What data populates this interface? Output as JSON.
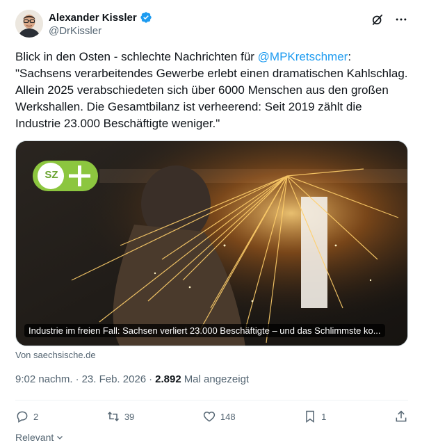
{
  "author": {
    "display_name": "Alexander Kissler",
    "handle": "@DrKissler",
    "verified": true
  },
  "header_icons": [
    "grok-icon",
    "more-icon"
  ],
  "tweet": {
    "text_before_mention": "Blick in den Osten - schlechte Nachrichten für ",
    "mention": "@MPKretschmer",
    "text_after_mention": ":\n\"Sachsens verarbeitendes Gewerbe erlebt einen dramatischen Kahlschlag. Allein 2025 verabschiedeten sich über 6000 Menschen aus den großen Werkshallen. Die Gesamtbilanz ist verheerend: Seit 2019 zählt die Industrie 23.000 Beschäftigte weniger.\""
  },
  "card": {
    "badge_text": "SZ",
    "caption": "Industrie im freien Fall: Sachsen verliert 23.000 Beschäftigte – und das Schlimmste ko...",
    "source": "Von saechsische.de"
  },
  "meta": {
    "time": "9:02 nachm.",
    "separator": "·",
    "date": "23. Feb. 2026",
    "separator2": "·",
    "views_count": "2.892",
    "views_label": "Mal angezeigt"
  },
  "actions": {
    "replies": "2",
    "reposts": "39",
    "likes": "148",
    "bookmarks": "1"
  },
  "footer": {
    "relevant_label": "Relevant"
  },
  "colors": {
    "accent": "#1d9bf0",
    "secondary_text": "#536471",
    "badge_green": "#8cc63f"
  }
}
